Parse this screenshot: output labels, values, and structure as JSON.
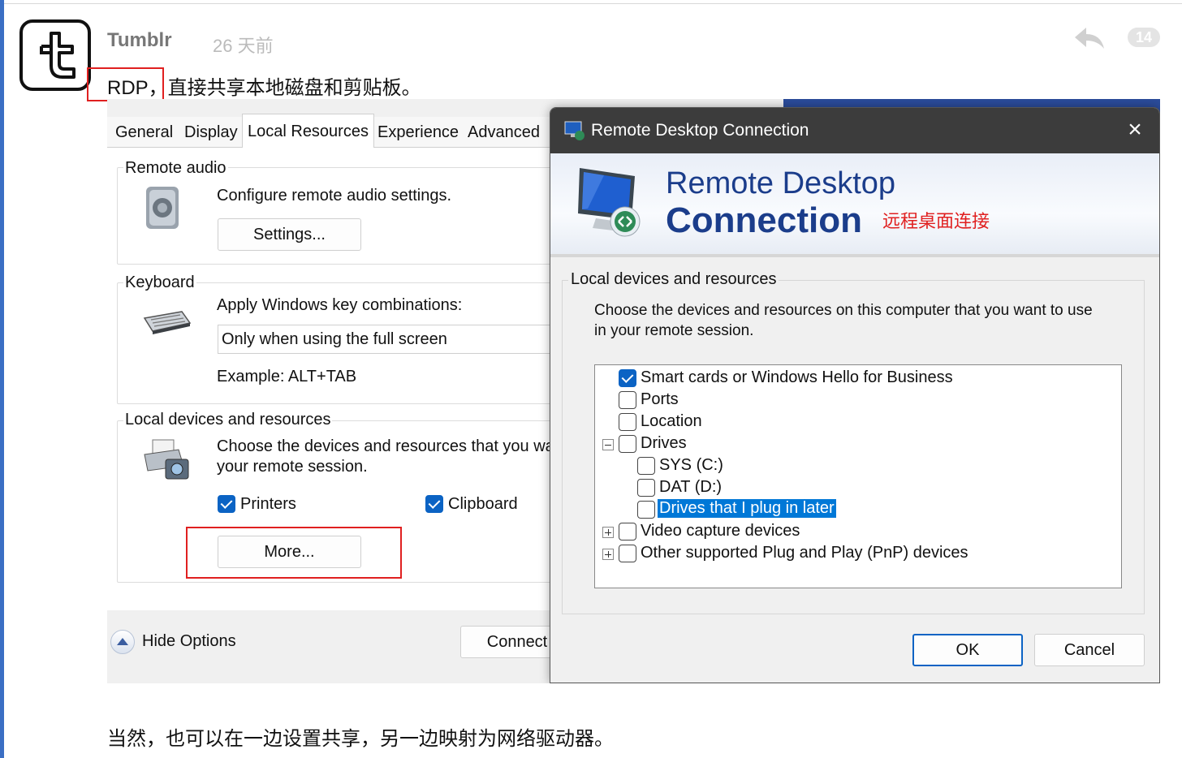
{
  "post": {
    "author": "Tumblr",
    "timestamp": "26 天前",
    "reply_count": "14",
    "line1_rdp": "RDP",
    "line1_rest": "，直接共享本地磁盘和剪贴板。",
    "line2": "当然，也可以在一边设置共享，另一边映射为网络驱动器。"
  },
  "options_dialog": {
    "tabs": [
      "General",
      "Display",
      "Local Resources",
      "Experience",
      "Advanced"
    ],
    "active_tab": "Local Resources",
    "remote_audio": {
      "title": "Remote audio",
      "desc": "Configure remote audio settings.",
      "button": "Settings..."
    },
    "keyboard": {
      "title": "Keyboard",
      "desc": "Apply Windows key combinations:",
      "combo_value": "Only when using the full screen",
      "example": "Example: ALT+TAB"
    },
    "local_devices": {
      "title": "Local devices and resources",
      "desc_line1": "Choose the devices and resources that you war",
      "desc_line2": "your remote session.",
      "printers": "Printers",
      "clipboard": "Clipboard",
      "more_button": "More..."
    },
    "hide_options": "Hide Options",
    "connect": "Connect"
  },
  "rdc_dialog": {
    "window_title": "Remote Desktop Connection",
    "banner_line1": "Remote Desktop",
    "banner_line2": "Connection",
    "annotation": "远程桌面连接",
    "group_title": "Local devices and resources",
    "description": "Choose the devices and resources on this computer that you want to use in your remote session.",
    "tree": [
      {
        "label": "Smart cards or Windows Hello for Business",
        "checked": true
      },
      {
        "label": "Ports",
        "checked": false
      },
      {
        "label": "Location",
        "checked": false
      },
      {
        "label": "Drives",
        "checked": false,
        "expander": "minus"
      },
      {
        "label": "SYS (C:)",
        "checked": false
      },
      {
        "label": "DAT (D:)",
        "checked": false
      },
      {
        "label": "Drives that I plug in later",
        "checked": false,
        "selected": true
      },
      {
        "label": "Video capture devices",
        "checked": false,
        "expander": "plus"
      },
      {
        "label": "Other supported Plug and Play (PnP) devices",
        "checked": false,
        "expander": "plus"
      }
    ],
    "ok": "OK",
    "cancel": "Cancel"
  },
  "colors": {
    "highlight_red": "#e02020",
    "accent_blue": "#0b63c4",
    "banner_text": "#1b3d8b"
  },
  "icons": [
    "tumblr-logo-icon",
    "reply-icon",
    "speaker-icon",
    "keyboard-icon",
    "printer-camera-icon",
    "rdc-monitor-icon",
    "hide-options-icon",
    "close-icon"
  ]
}
